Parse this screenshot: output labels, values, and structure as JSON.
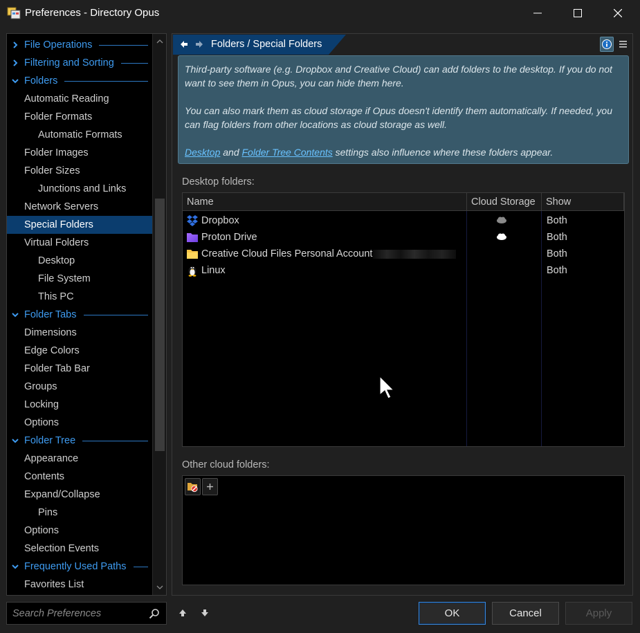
{
  "window": {
    "title": "Preferences - Directory Opus"
  },
  "sidebar": {
    "items": [
      {
        "label": "File Operations",
        "type": "section",
        "expanded": false
      },
      {
        "label": "Filtering and Sorting",
        "type": "section",
        "expanded": false
      },
      {
        "label": "Folders",
        "type": "section",
        "expanded": true
      },
      {
        "label": "Automatic Reading",
        "level": 1
      },
      {
        "label": "Folder Formats",
        "level": 1
      },
      {
        "label": "Automatic Formats",
        "level": 2
      },
      {
        "label": "Folder Images",
        "level": 1
      },
      {
        "label": "Folder Sizes",
        "level": 1
      },
      {
        "label": "Junctions and Links",
        "level": 2
      },
      {
        "label": "Network Servers",
        "level": 1
      },
      {
        "label": "Special Folders",
        "level": 1,
        "selected": true
      },
      {
        "label": "Virtual Folders",
        "level": 1
      },
      {
        "label": "Desktop",
        "level": 2
      },
      {
        "label": "File System",
        "level": 2
      },
      {
        "label": "This PC",
        "level": 2
      },
      {
        "label": "Folder Tabs",
        "type": "section",
        "expanded": true
      },
      {
        "label": "Dimensions",
        "level": 1
      },
      {
        "label": "Edge Colors",
        "level": 1
      },
      {
        "label": "Folder Tab Bar",
        "level": 1
      },
      {
        "label": "Groups",
        "level": 1
      },
      {
        "label": "Locking",
        "level": 1
      },
      {
        "label": "Options",
        "level": 1
      },
      {
        "label": "Folder Tree",
        "type": "section",
        "expanded": true
      },
      {
        "label": "Appearance",
        "level": 1
      },
      {
        "label": "Contents",
        "level": 1
      },
      {
        "label": "Expand/Collapse",
        "level": 1
      },
      {
        "label": "Pins",
        "level": 2
      },
      {
        "label": "Options",
        "level": 1
      },
      {
        "label": "Selection Events",
        "level": 1
      },
      {
        "label": "Frequently Used Paths",
        "type": "section",
        "expanded": true
      },
      {
        "label": "Favorites List",
        "level": 1
      }
    ]
  },
  "search": {
    "placeholder": "Search Preferences"
  },
  "main": {
    "breadcrumb": "Folders / Special Folders",
    "info": {
      "para1": "Third-party software (e.g. Dropbox and Creative Cloud) can add folders to the desktop. If you do not want to see them in Opus, you can hide them here.",
      "para2": "You can also mark them as cloud storage if Opus doesn't identify them automatically. If needed, you can flag folders from other locations as cloud storage as well.",
      "link1": "Desktop",
      "and": "and",
      "link2": "Folder Tree Contents",
      "para3_tail": "settings also influence where these folders appear."
    },
    "desktop_label": "Desktop folders:",
    "columns": {
      "name": "Name",
      "cloud": "Cloud Storage",
      "show": "Show"
    },
    "rows": [
      {
        "name": "Dropbox",
        "icon": "dropbox-icon",
        "cloud": "gray-cloud",
        "show": "Both"
      },
      {
        "name": "Proton Drive",
        "icon": "proton-drive-icon",
        "cloud": "white-cloud",
        "show": "Both"
      },
      {
        "name": "Creative Cloud Files Personal Account",
        "icon": "folder-icon",
        "cloud": "",
        "show": "Both"
      },
      {
        "name": "Linux",
        "icon": "linux-penguin-icon",
        "cloud": "",
        "show": "Both"
      }
    ],
    "other_label": "Other cloud folders:"
  },
  "buttons": {
    "ok": "OK",
    "cancel": "Cancel",
    "apply": "Apply"
  },
  "colors": {
    "accent": "#3e9bf0",
    "selected": "#0b3d6e",
    "info_bg": "#38596a",
    "link": "#69c2ff"
  }
}
